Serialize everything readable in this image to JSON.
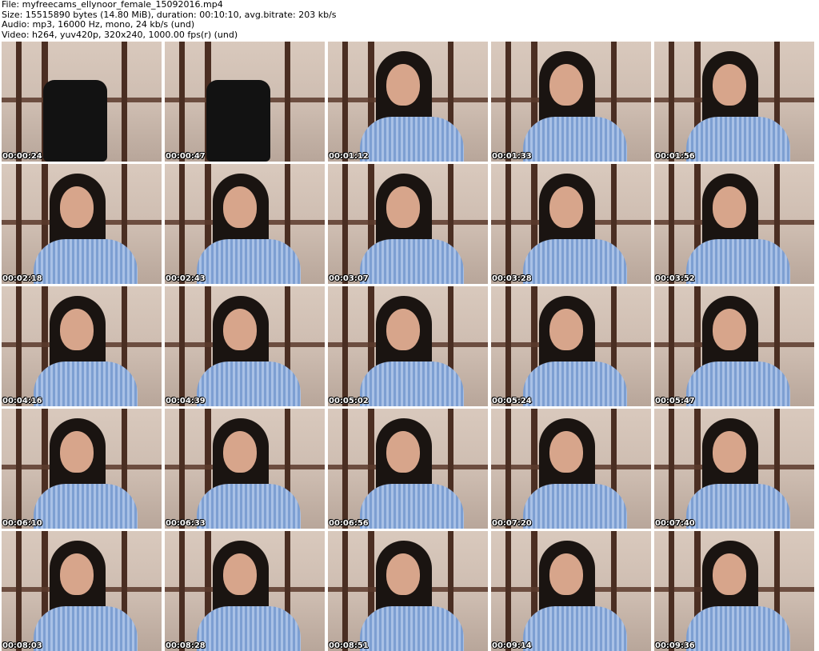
{
  "header": {
    "file": "File: myfreecams_ellynoor_female_15092016.mp4",
    "size": "Size: 15515890 bytes (14.80 MiB), duration: 00:10:10, avg.bitrate: 203 kb/s",
    "audio": "Audio: mp3, 16000 Hz, mono, 24 kb/s (und)",
    "video": "Video: h264, yuv420p, 320x240, 1000.00 fps(r) (und)"
  },
  "thumbnails": [
    {
      "time": "00:00:24",
      "empty": true
    },
    {
      "time": "00:00:47",
      "empty": true
    },
    {
      "time": "00:01:12"
    },
    {
      "time": "00:01:33"
    },
    {
      "time": "00:01:56"
    },
    {
      "time": "00:02:18"
    },
    {
      "time": "00:02:43"
    },
    {
      "time": "00:03:07"
    },
    {
      "time": "00:03:28"
    },
    {
      "time": "00:03:52"
    },
    {
      "time": "00:04:16"
    },
    {
      "time": "00:04:39"
    },
    {
      "time": "00:05:02"
    },
    {
      "time": "00:05:24"
    },
    {
      "time": "00:05:47"
    },
    {
      "time": "00:06:10"
    },
    {
      "time": "00:06:33"
    },
    {
      "time": "00:06:56"
    },
    {
      "time": "00:07:20"
    },
    {
      "time": "00:07:40"
    },
    {
      "time": "00:08:03"
    },
    {
      "time": "00:08:28"
    },
    {
      "time": "00:08:51"
    },
    {
      "time": "00:09:14"
    },
    {
      "time": "00:09:36"
    }
  ]
}
